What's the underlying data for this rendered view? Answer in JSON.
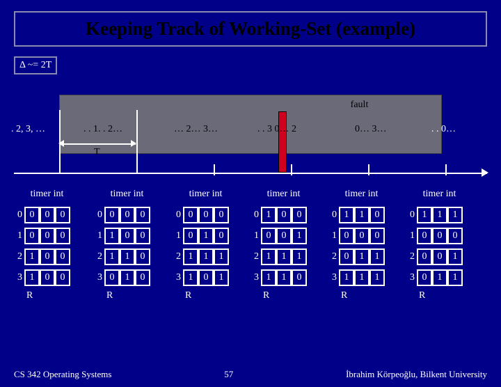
{
  "title": "Keeping Track of Working-Set (example)",
  "delta_text": "Δ ~= 2T",
  "fault_label": "fault",
  "t_label": "T",
  "sequences": [
    ". 2, 3, …",
    ". . 1. . 2…",
    "… 2… 3…",
    ". . 3   0… 2",
    "0… 3…",
    ". . 0…"
  ],
  "timer_label": "timer int",
  "r_label": "R",
  "tables": [
    {
      "rows": [
        [
          "0",
          "0",
          "0"
        ],
        [
          "0",
          "0",
          "0"
        ],
        [
          "1",
          "0",
          "0"
        ],
        [
          "1",
          "0",
          "0"
        ]
      ],
      "page_ids": [
        "0",
        "1",
        "2",
        "3"
      ]
    },
    {
      "rows": [
        [
          "0",
          "0",
          "0"
        ],
        [
          "1",
          "0",
          "0"
        ],
        [
          "1",
          "1",
          "0"
        ],
        [
          "0",
          "1",
          "0"
        ]
      ],
      "page_ids": [
        "0",
        "1",
        "2",
        "3"
      ]
    },
    {
      "rows": [
        [
          "0",
          "0",
          "0"
        ],
        [
          "0",
          "1",
          "0"
        ],
        [
          "1",
          "1",
          "1"
        ],
        [
          "1",
          "0",
          "1"
        ]
      ],
      "page_ids": [
        "0",
        "1",
        "2",
        "3"
      ]
    },
    {
      "rows": [
        [
          "1",
          "0",
          "0"
        ],
        [
          "0",
          "0",
          "1"
        ],
        [
          "1",
          "1",
          "1"
        ],
        [
          "1",
          "1",
          "0"
        ]
      ],
      "page_ids": [
        "0",
        "1",
        "2",
        "3"
      ]
    },
    {
      "rows": [
        [
          "1",
          "1",
          "0"
        ],
        [
          "0",
          "0",
          "0"
        ],
        [
          "0",
          "1",
          "1"
        ],
        [
          "1",
          "1",
          "1"
        ]
      ],
      "page_ids": [
        "0",
        "1",
        "2",
        "3"
      ]
    },
    {
      "rows": [
        [
          "1",
          "1",
          "1"
        ],
        [
          "0",
          "0",
          "0"
        ],
        [
          "0",
          "0",
          "1"
        ],
        [
          "0",
          "1",
          "1"
        ]
      ],
      "page_ids": [
        "0",
        "1",
        "2",
        "3"
      ]
    }
  ],
  "footer": {
    "left": "CS 342 Operating Systems",
    "center": "57",
    "right": "İbrahim Körpeoğlu, Bilkent University"
  }
}
